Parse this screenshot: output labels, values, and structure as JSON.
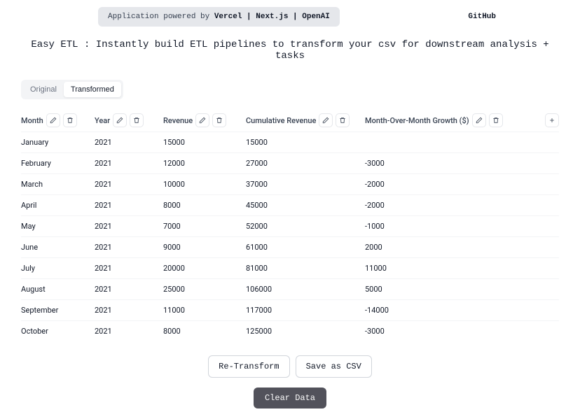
{
  "header": {
    "powered_prefix": "Application powered by ",
    "powered_strong": "Vercel | Next.js | OpenAI",
    "github": "GitHub"
  },
  "tagline": "Easy ETL : Instantly build ETL pipelines to transform your csv for downstream analysis + tasks",
  "tabs": {
    "original": "Original",
    "transformed": "Transformed"
  },
  "columns": {
    "month": "Month",
    "year": "Year",
    "revenue": "Revenue",
    "cumulative": "Cumulative Revenue",
    "mom": "Month-Over-Month Growth ($)"
  },
  "rows": [
    {
      "month": "January",
      "year": "2021",
      "revenue": "15000",
      "cumulative": "15000",
      "mom": ""
    },
    {
      "month": "February",
      "year": "2021",
      "revenue": "12000",
      "cumulative": "27000",
      "mom": "-3000"
    },
    {
      "month": "March",
      "year": "2021",
      "revenue": "10000",
      "cumulative": "37000",
      "mom": "-2000"
    },
    {
      "month": "April",
      "year": "2021",
      "revenue": "8000",
      "cumulative": "45000",
      "mom": "-2000"
    },
    {
      "month": "May",
      "year": "2021",
      "revenue": "7000",
      "cumulative": "52000",
      "mom": "-1000"
    },
    {
      "month": "June",
      "year": "2021",
      "revenue": "9000",
      "cumulative": "61000",
      "mom": "2000"
    },
    {
      "month": "July",
      "year": "2021",
      "revenue": "20000",
      "cumulative": "81000",
      "mom": "11000"
    },
    {
      "month": "August",
      "year": "2021",
      "revenue": "25000",
      "cumulative": "106000",
      "mom": "5000"
    },
    {
      "month": "September",
      "year": "2021",
      "revenue": "11000",
      "cumulative": "117000",
      "mom": "-14000"
    },
    {
      "month": "October",
      "year": "2021",
      "revenue": "8000",
      "cumulative": "125000",
      "mom": "-3000"
    }
  ],
  "buttons": {
    "retransform": "Re-Transform",
    "save_csv": "Save as CSV",
    "clear": "Clear Data"
  },
  "icons": {
    "plus": "+"
  }
}
